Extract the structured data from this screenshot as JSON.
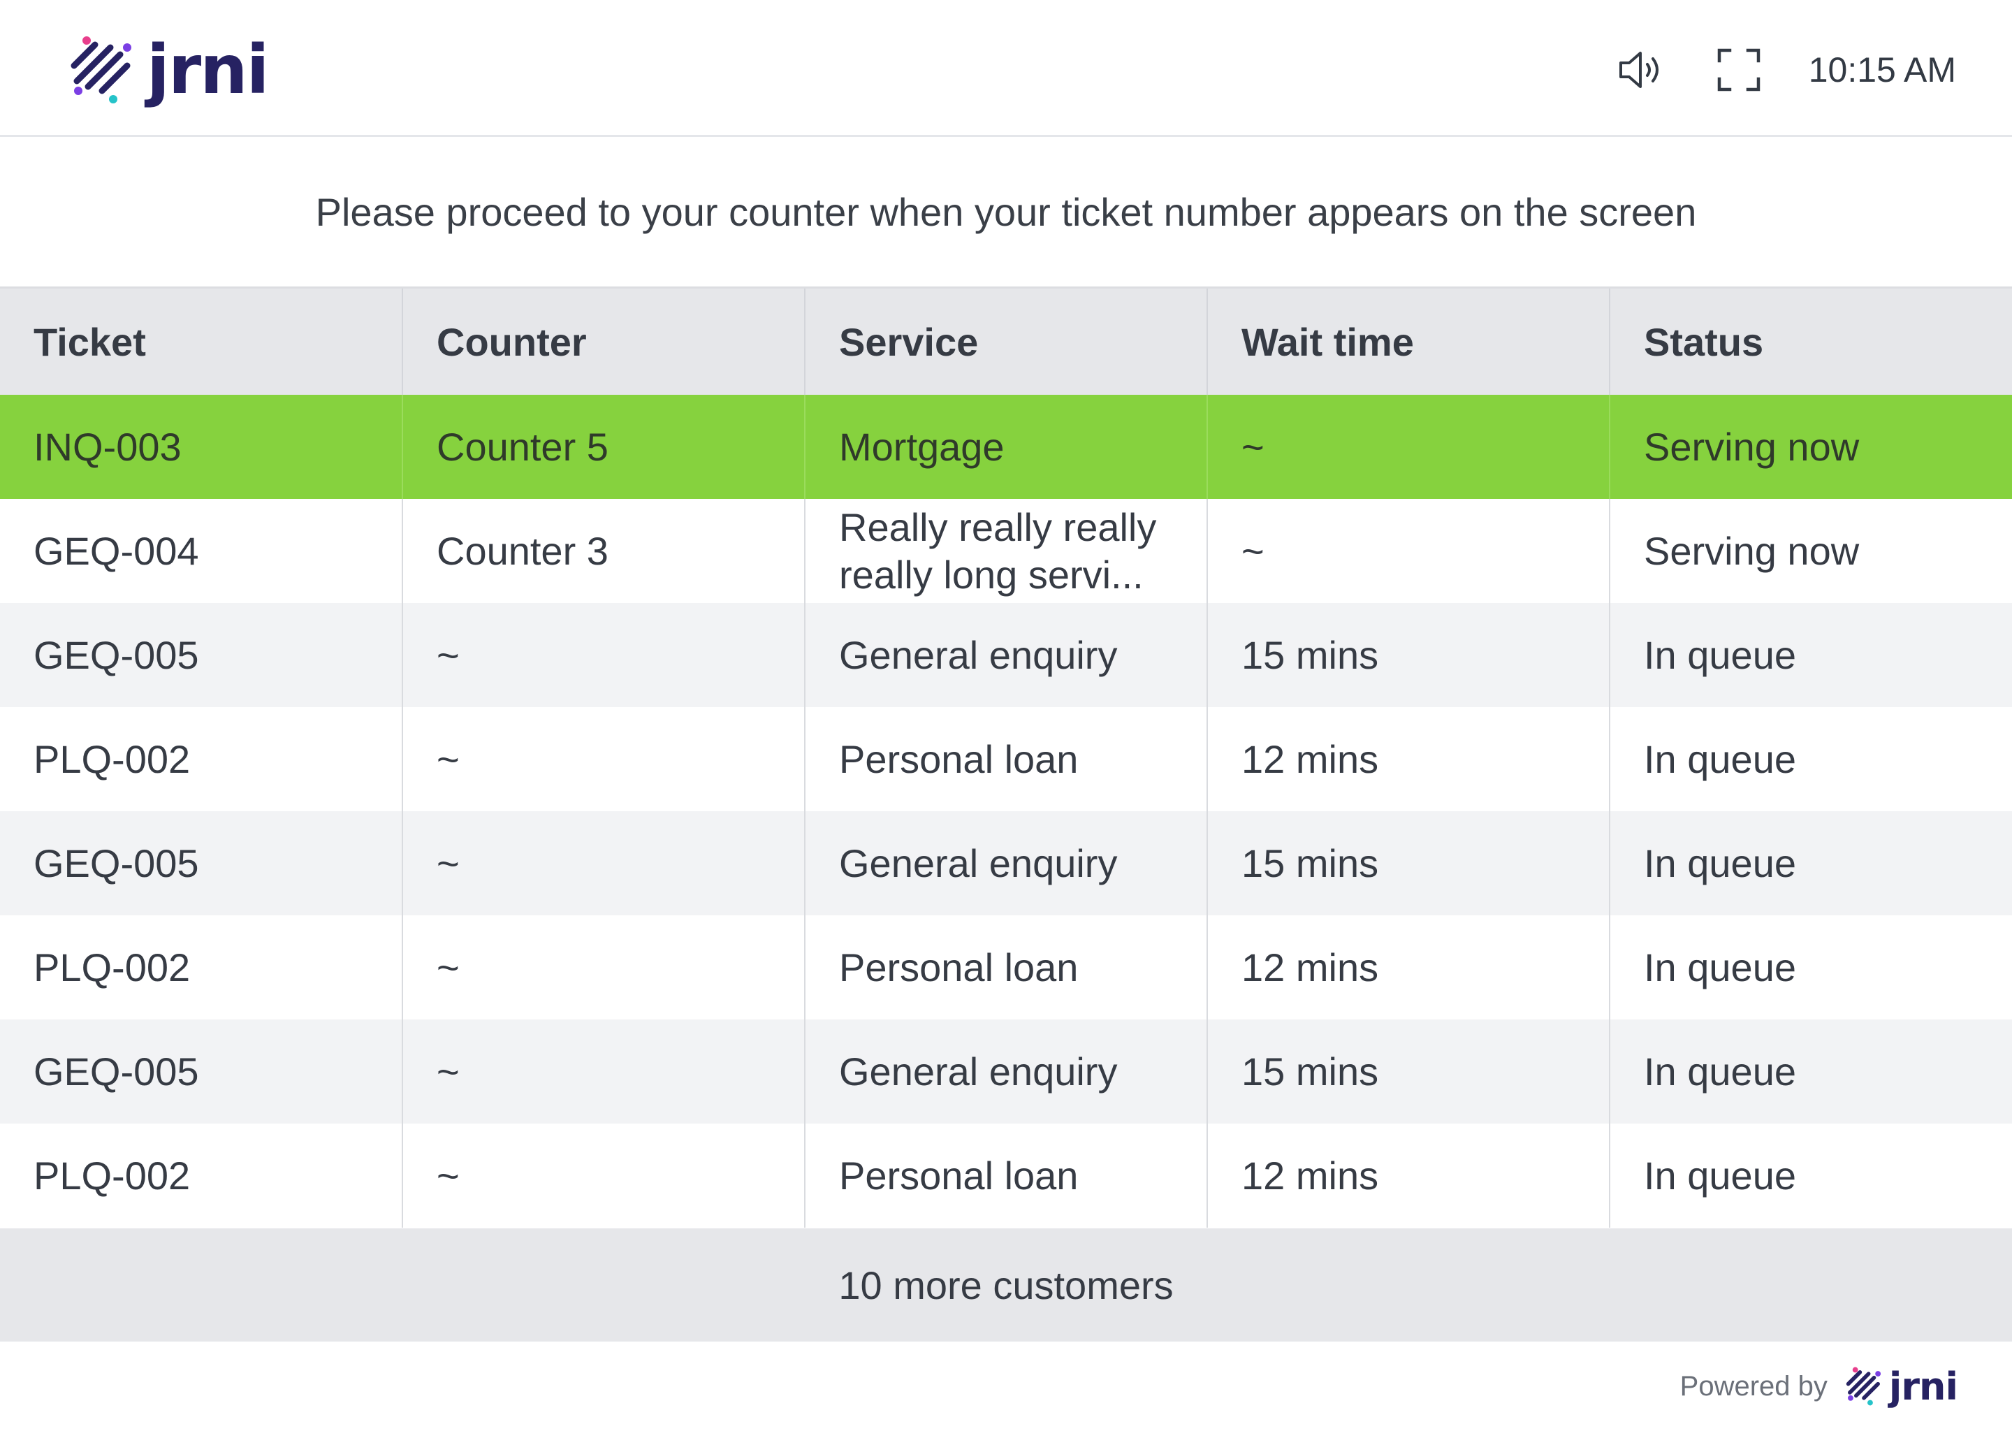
{
  "header": {
    "brand": "jrni",
    "clock": "10:15 AM",
    "icons": [
      "volume-icon",
      "fullscreen-icon"
    ]
  },
  "instruction": "Please proceed to your counter when your ticket number appears on the screen",
  "table": {
    "columns": [
      "Ticket",
      "Counter",
      "Service",
      "Wait time",
      "Status"
    ],
    "rows": [
      {
        "ticket": "INQ-003",
        "counter": "Counter 5",
        "service": "Mortgage",
        "wait": "~",
        "status": "Serving now"
      },
      {
        "ticket": "GEQ-004",
        "counter": "Counter 3",
        "service": "Really really really really long servi...",
        "wait": "~",
        "status": "Serving now"
      },
      {
        "ticket": "GEQ-005",
        "counter": "~",
        "service": "General enquiry",
        "wait": "15 mins",
        "status": "In queue"
      },
      {
        "ticket": "PLQ-002",
        "counter": "~",
        "service": "Personal loan",
        "wait": "12 mins",
        "status": "In queue"
      },
      {
        "ticket": "GEQ-005",
        "counter": "~",
        "service": "General enquiry",
        "wait": "15 mins",
        "status": "In queue"
      },
      {
        "ticket": "PLQ-002",
        "counter": "~",
        "service": "Personal loan",
        "wait": "12 mins",
        "status": "In queue"
      },
      {
        "ticket": "GEQ-005",
        "counter": "~",
        "service": "General enquiry",
        "wait": "15 mins",
        "status": "In queue"
      },
      {
        "ticket": "PLQ-002",
        "counter": "~",
        "service": "Personal loan",
        "wait": "12 mins",
        "status": "In queue"
      }
    ]
  },
  "more_customers": "10 more customers",
  "footer": {
    "powered_by": "Powered by",
    "brand": "jrni"
  },
  "colors": {
    "active_row": "#86d23e",
    "brand_navy": "#262262",
    "header_bg": "#e6e7ea",
    "alt_row": "#f2f3f5"
  }
}
